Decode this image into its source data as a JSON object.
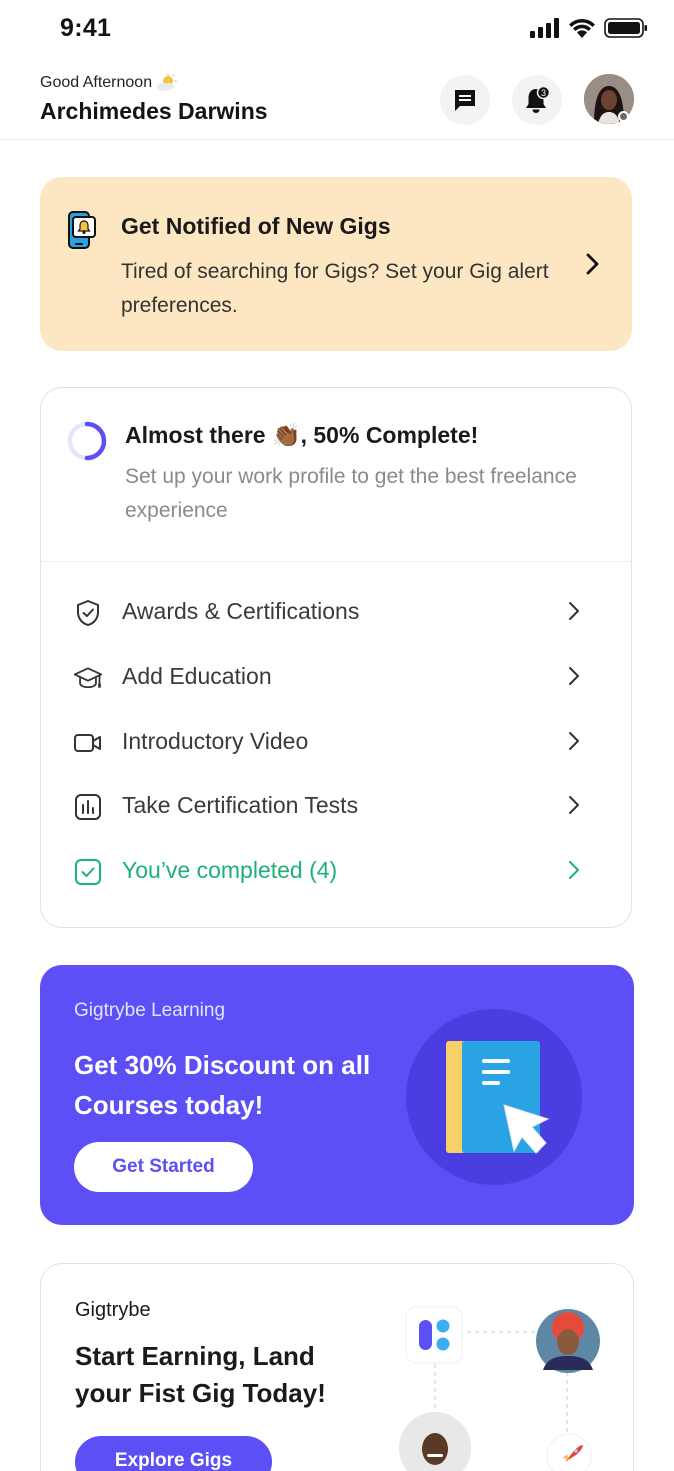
{
  "status_bar": {
    "time": "9:41",
    "icons": [
      "cellular-signal-icon",
      "wifi-icon",
      "battery-icon"
    ]
  },
  "header": {
    "greeting": "Good Afternoon",
    "greeting_icon": "partly-sunny-icon",
    "user_name": "Archimedes Darwins",
    "notification_count": "3",
    "icons": [
      "chat-icon",
      "bell-icon"
    ]
  },
  "gig_alert": {
    "title": "Get Notified of New Gigs",
    "description": "Tired of searching for Gigs? Set your Gig alert preferences.",
    "icon": "phone-bell-icon"
  },
  "profile_progress": {
    "title": "Almost there 👏🏾, 50% Complete!",
    "description": "Set up your work profile to get the best freelance experience",
    "progress": 0.5,
    "tasks": [
      {
        "label": "Awards & Certifications",
        "icon": "shield-check-icon"
      },
      {
        "label": "Add Education",
        "icon": "graduation-cap-icon"
      },
      {
        "label": "Introductory Video",
        "icon": "video-camera-icon"
      },
      {
        "label": "Take Certification Tests",
        "icon": "bar-chart-icon"
      }
    ],
    "completed": {
      "label": "You’ve completed (4)",
      "icon": "check-square-icon"
    }
  },
  "learning_promo": {
    "brand": "Gigtrybe Learning",
    "title": "Get 30% Discount on all Courses today!",
    "button": "Get Started",
    "illustration": "book-cursor-icon"
  },
  "earn_card": {
    "brand": "Gigtrybe",
    "title": "Start Earning, Land your Fist Gig Today!",
    "button": "Explore Gigs",
    "illustration_icons": [
      "gigtrybe-logo-icon",
      "rocket-icon"
    ]
  },
  "colors": {
    "primary": "#5b4ff5",
    "alert_bg": "#fde7c2",
    "success": "#1fb079",
    "muted_text": "#8a8a8a"
  }
}
